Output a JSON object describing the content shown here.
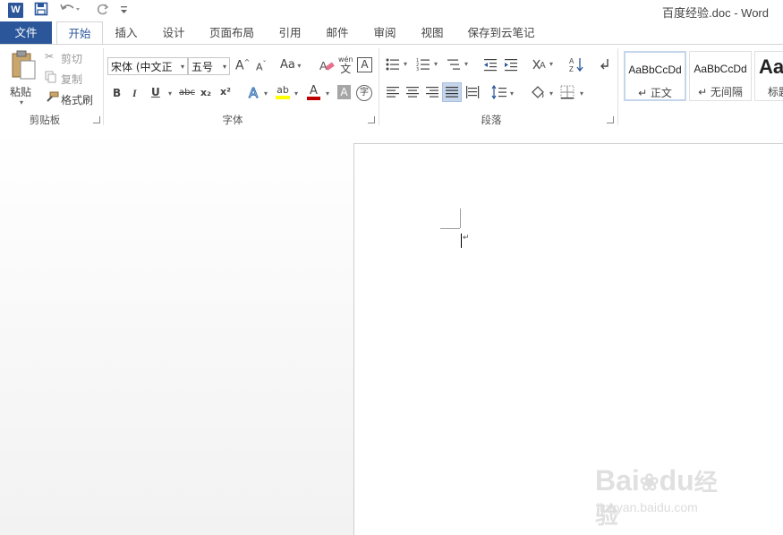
{
  "titlebar": {
    "app_icon_letter": "W",
    "document_title": "百度经验.doc - Word",
    "qa_save_icon": "save-icon",
    "qa_undo_icon": "undo-icon",
    "qa_redo_icon": "redo-icon",
    "qa_customize_icon": "customize-icon"
  },
  "tabs": {
    "file": "文件",
    "home": "开始",
    "insert": "插入",
    "design": "设计",
    "layout": "页面布局",
    "references": "引用",
    "mailings": "邮件",
    "review": "审阅",
    "view": "视图",
    "cloud": "保存到云笔记",
    "active": "开始"
  },
  "clipboard": {
    "paste": "粘贴",
    "cut": "剪切",
    "copy": "复制",
    "format_painter": "格式刷",
    "group_label": "剪贴板"
  },
  "font": {
    "font_name": "宋体 (中文正",
    "font_size": "五号",
    "grow_glyph": "A",
    "shrink_glyph": "A",
    "case_glyph": "Aa",
    "phonetic_glyph": "wén",
    "phonetic_char": "文",
    "border_glyph": "A",
    "bold": "B",
    "italic": "I",
    "underline": "U",
    "strike": "abc",
    "subscript": "x₂",
    "superscript": "x²",
    "effects_glyph": "A",
    "highlight_glyph": "ab",
    "color_glyph": "A",
    "shading_glyph": "A",
    "enclose_glyph": "字",
    "group_label": "字体",
    "highlight_color": "#ffff00",
    "font_color": "#c00000"
  },
  "paragraph": {
    "group_label": "段落"
  },
  "styles": {
    "items": [
      {
        "sample": "AaBbCcDd",
        "name": "↵ 正文"
      },
      {
        "sample": "AaBbCcDd",
        "name": "↵ 无间隔"
      },
      {
        "sample": "Aa",
        "name": "标题"
      }
    ]
  },
  "watermark": {
    "brand": "Bai",
    "brand2": "du",
    "brand_cn": "经验",
    "url": "jingyan.baidu.com"
  },
  "colors": {
    "accent": "#2b579a"
  }
}
